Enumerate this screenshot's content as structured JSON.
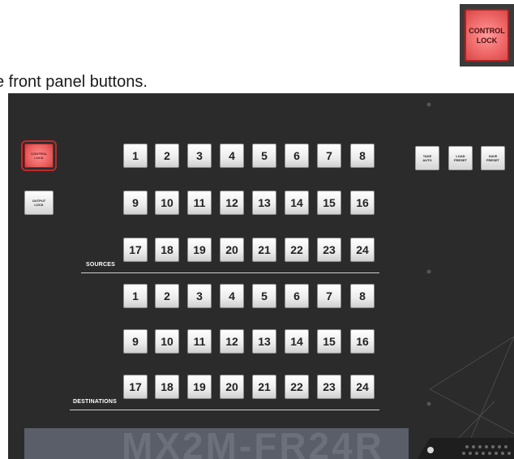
{
  "intro_text": "e front panel buttons.",
  "callout": {
    "line1": "CONTROL",
    "line2": "LOCK"
  },
  "panel": {
    "control_lock": {
      "line1": "CONTROL",
      "line2": "LOCK"
    },
    "output_lock": {
      "line1": "OUTPUT",
      "line2": "LOCK"
    },
    "take": {
      "line1": "TAKE",
      "line2": "AUTO"
    },
    "load_preset": {
      "line1": "LOAD",
      "line2": "PRESET"
    },
    "save_preset": {
      "line1": "SAVE",
      "line2": "PRESET"
    },
    "sources_label": "SOURCES",
    "destinations_label": "DESTINATIONS",
    "model": "MX2M-FR24R",
    "sources": [
      "1",
      "2",
      "3",
      "4",
      "5",
      "6",
      "7",
      "8",
      "9",
      "10",
      "11",
      "12",
      "13",
      "14",
      "15",
      "16",
      "17",
      "18",
      "19",
      "20",
      "21",
      "22",
      "23",
      "24"
    ],
    "destinations": [
      "1",
      "2",
      "3",
      "4",
      "5",
      "6",
      "7",
      "8",
      "9",
      "10",
      "11",
      "12",
      "13",
      "14",
      "15",
      "16",
      "17",
      "18",
      "19",
      "20",
      "21",
      "22",
      "23",
      "24"
    ]
  },
  "colors": {
    "panel": "#2b2b2c",
    "lock_active": "#e85a5a",
    "model_band": "#5a5e68"
  }
}
